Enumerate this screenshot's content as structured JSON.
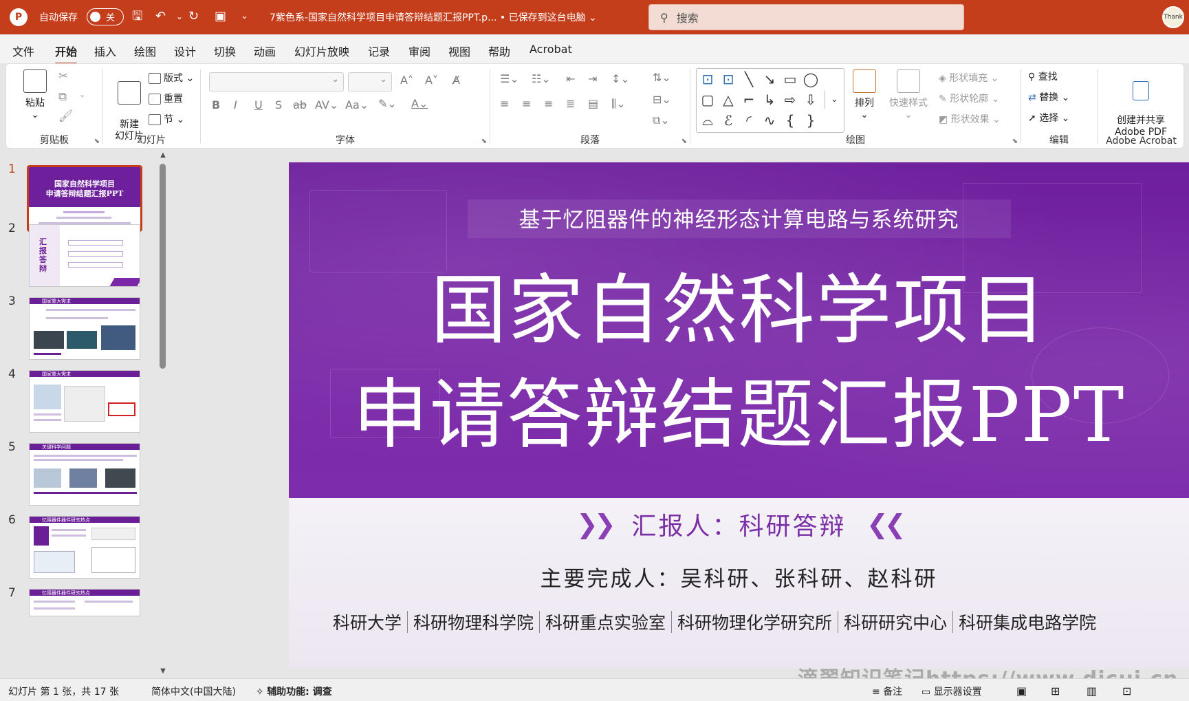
{
  "titlebar": {
    "autosave_label": "自动保存",
    "toggle_state": "关",
    "filename": "7紫色系-国家自然科学项目申请答辩结题汇报PPT.p...  •  已保存到这台电脑 ⌄",
    "search_placeholder": "搜索",
    "avatar_text": "Thank",
    "accent_color": "#c43e1c"
  },
  "menu": {
    "tabs": [
      "文件",
      "开始",
      "插入",
      "绘图",
      "设计",
      "切换",
      "动画",
      "幻灯片放映",
      "记录",
      "审阅",
      "视图",
      "帮助",
      "Acrobat"
    ],
    "active_index": 1
  },
  "ribbon": {
    "clipboard": {
      "paste": "粘贴",
      "label": "剪贴板"
    },
    "slides": {
      "new_slide": "新建\n幻灯片",
      "layout": "版式 ⌄",
      "reset": "重置",
      "section": "节 ⌄",
      "label": "幻灯片"
    },
    "font": {
      "label": "字体"
    },
    "paragraph": {
      "label": "段落"
    },
    "drawing": {
      "arrange": "排列",
      "quick_styles": "快速样式",
      "shape_fill": "形状填充 ⌄",
      "shape_outline": "形状轮廓 ⌄",
      "shape_effects": "形状效果 ⌄",
      "label": "绘图"
    },
    "editing": {
      "find": "查找",
      "replace": "替换",
      "select": "选择 ⌄",
      "label": "编辑"
    },
    "acrobat": {
      "create_share": "创建并共享\nAdobe PDF",
      "label": "Adobe Acrobat"
    }
  },
  "thumbnails": [
    {
      "num": "1",
      "title_line1": "国家自然科学项目",
      "title_line2": "申请答辩结题汇报PPT"
    },
    {
      "num": "2",
      "title": "汇报答辩"
    },
    {
      "num": "3",
      "title": "国家重大需求"
    },
    {
      "num": "4",
      "title": "国家重大需求"
    },
    {
      "num": "5",
      "title": "关键科学问题"
    },
    {
      "num": "6",
      "title": "忆阻器件器件研究热点"
    },
    {
      "num": "7",
      "title": "忆阻器件器件研究热点"
    }
  ],
  "slide": {
    "subtitle": "基于忆阻器件的神经形态计算电路与系统研究",
    "title_line1": "国家自然科学项目",
    "title_line2": "申请答辩结题汇报PPT",
    "reporter": "汇报人：科研答辩",
    "authors": "主要完成人：吴科研、张科研、赵科研",
    "institutions": [
      "科研大学",
      "科研物理科学院",
      "科研重点实验室",
      "科研物理化学研究所",
      "科研研究中心",
      "科研集成电路学院"
    ],
    "primary_color": "#7b2ba8"
  },
  "statusbar": {
    "slide_info": "幻灯片 第 1 张，共 17 张",
    "language": "简体中文(中国大陆)",
    "accessibility": "辅助功能: 调查",
    "notes": "备注",
    "display_settings": "显示器设置"
  },
  "watermark": "滴翠知识笔记https://www.dicui.cn"
}
